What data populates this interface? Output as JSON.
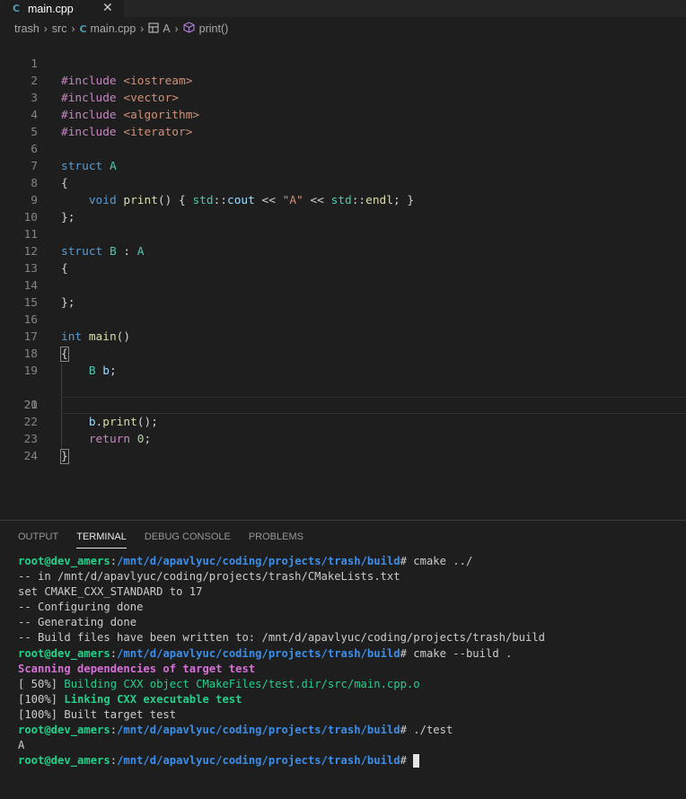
{
  "tab": {
    "icon": "cpp-file-icon",
    "label": "main.cpp",
    "close": "✕"
  },
  "breadcrumb": {
    "items": [
      "trash",
      "src",
      "main.cpp",
      "A",
      "print()"
    ]
  },
  "editor": {
    "lines": [
      {
        "n": "1"
      },
      {
        "n": "2"
      },
      {
        "n": "3"
      },
      {
        "n": "4"
      },
      {
        "n": "5"
      },
      {
        "n": "6"
      },
      {
        "n": "7"
      },
      {
        "n": "8"
      },
      {
        "n": "9"
      },
      {
        "n": "10"
      },
      {
        "n": "11"
      },
      {
        "n": "12"
      },
      {
        "n": "13"
      },
      {
        "n": "14"
      },
      {
        "n": "15"
      },
      {
        "n": "16"
      },
      {
        "n": "17"
      },
      {
        "n": "18"
      },
      {
        "n": "19"
      },
      {
        "n": "20"
      },
      {
        "n": "21"
      },
      {
        "n": "22"
      },
      {
        "n": "23"
      },
      {
        "n": "24"
      }
    ],
    "code": {
      "l1_dir": "#include",
      "l1_arg": "<iostream>",
      "l2_dir": "#include",
      "l2_arg": "<vector>",
      "l3_dir": "#include",
      "l3_arg": "<algorithm>",
      "l4_dir": "#include",
      "l4_arg": "<iterator>",
      "l6_kw": "struct",
      "l6_name": "A",
      "l7": "{",
      "l8_void": "void",
      "l8_fn": "print",
      "l8_a": "() { ",
      "l8_ns1": "std",
      "l8_sep1": "::",
      "l8_cout": "cout",
      "l8_op1": " << ",
      "l8_str": "\"A\"",
      "l8_op2": " << ",
      "l8_ns2": "std",
      "l8_sep2": "::",
      "l8_endl": "endl",
      "l8_end": "; }",
      "l9": "};",
      "l11_kw": "struct",
      "l11_name": "B",
      "l11_colon": " : ",
      "l11_base": "A",
      "l12": "{",
      "l14": "};",
      "l16_kw": "int",
      "l16_fn": "main",
      "l16_paren": "()",
      "l17": "{",
      "l18_type": "B",
      "l18_var": "b",
      "l18_semi": ";",
      "l20_var": "b",
      "l20_dot": ".",
      "l20_fn": "print",
      "l20_end": "();",
      "l22_kw": "return",
      "l22_num": "0",
      "l22_semi": ";",
      "l23": "}"
    }
  },
  "panel": {
    "tabs": [
      "OUTPUT",
      "TERMINAL",
      "DEBUG CONSOLE",
      "PROBLEMS"
    ],
    "active_tab": "TERMINAL"
  },
  "terminal": {
    "user": "root@dev_amers",
    "colon": ":",
    "path": "/mnt/d/apavlyuc/coding/projects/trash/build",
    "hash": "#",
    "cmd1": " cmake ../",
    "out1": "-- in /mnt/d/apavlyuc/coding/projects/trash/CMakeLists.txt",
    "out2": "set CMAKE_CXX_STANDARD to 17",
    "out3": "-- Configuring done",
    "out4": "-- Generating done",
    "out5": "-- Build files have been written to: /mnt/d/apavlyuc/coding/projects/trash/build",
    "cmd2": " cmake --build .",
    "out6": "Scanning dependencies of target test",
    "out7_pct": "[ 50%]",
    "out7_msg": " Building CXX object CMakeFiles/test.dir/src/main.cpp.o",
    "out8_pct": "[100%]",
    "out8_msg": " Linking CXX executable test",
    "out9": "[100%] Built target test",
    "cmd3": " ./test",
    "out10": "A",
    "prompt_tail": " "
  },
  "colors": {
    "editor_bg": "#1e1e1e",
    "keyword": "#569cd6",
    "preprocessor": "#c586c0",
    "type": "#4ec9b0",
    "function": "#dcdcaa",
    "string": "#ce9178",
    "terminal_user": "#23d18b",
    "terminal_path": "#3b8eea"
  }
}
